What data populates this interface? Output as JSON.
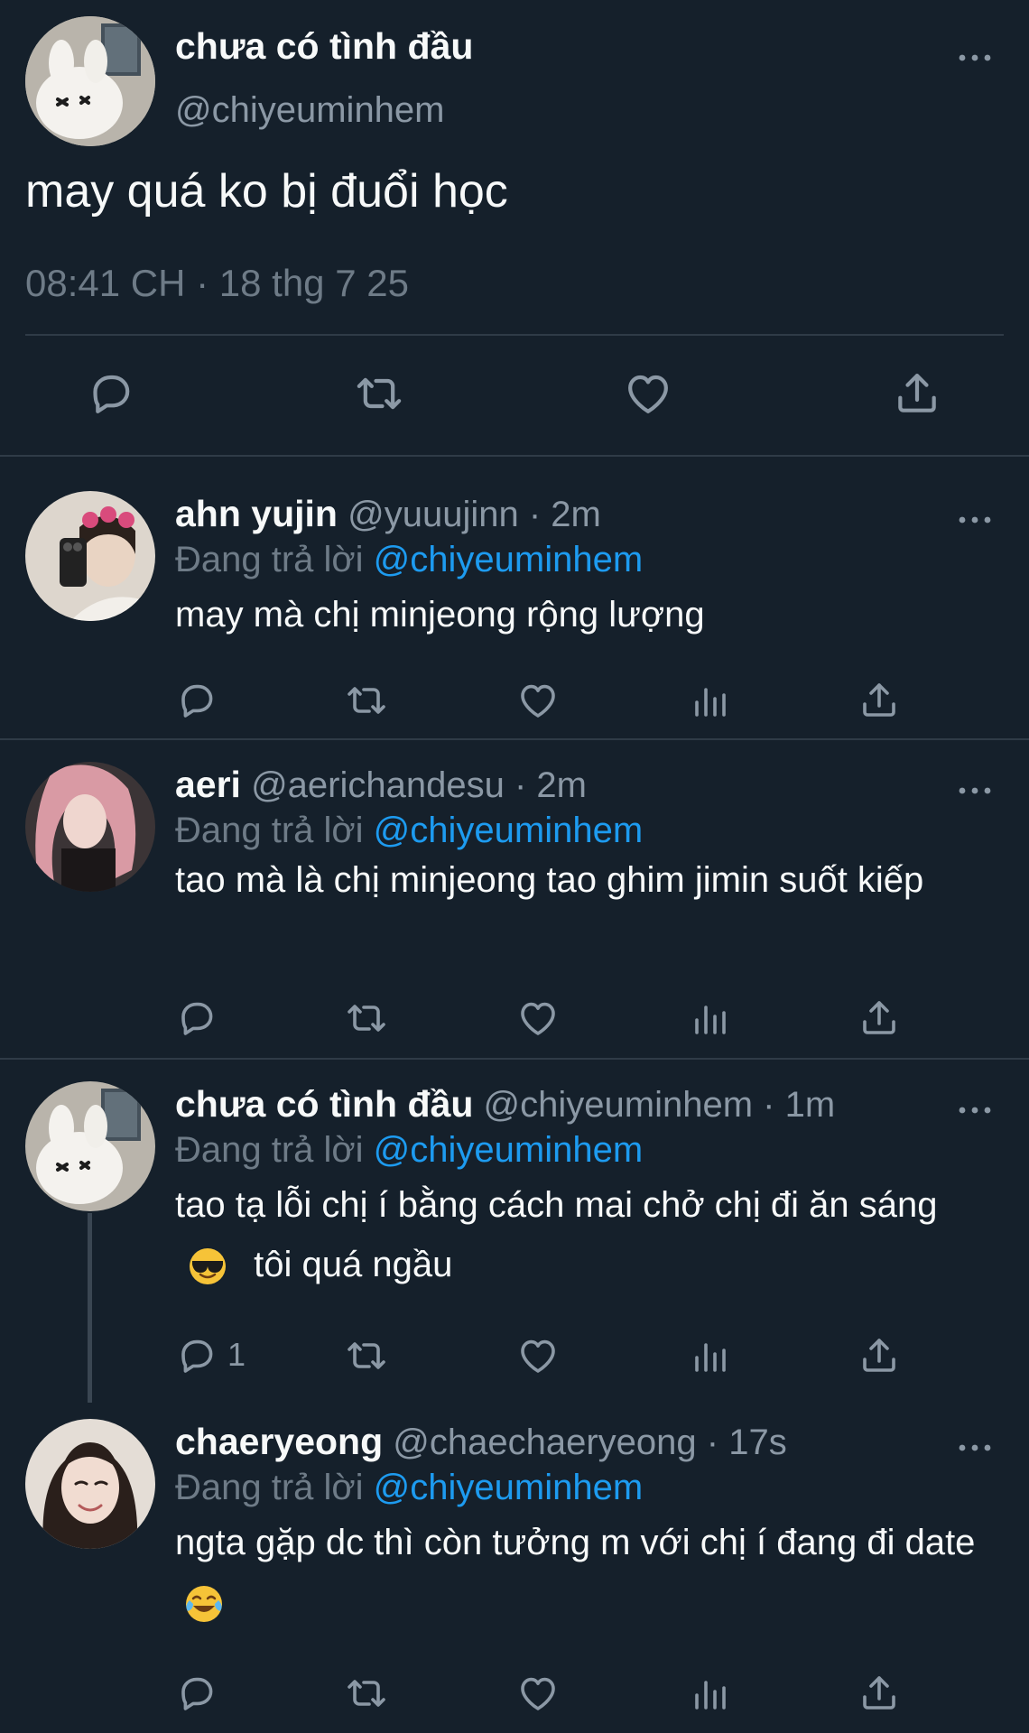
{
  "main_tweet": {
    "display_name": "chưa có tình đầu",
    "handle": "@chiyeuminhem",
    "text": "may quá ko bị đuổi học",
    "timestamp": "08:41 CH · 18 thg 7 25",
    "actions": [
      "reply-icon",
      "retweet-icon",
      "like-icon",
      "share-icon"
    ]
  },
  "replies": [
    {
      "display_name": "ahn yujin",
      "handle": "@yuuujinn",
      "time": "· 2m",
      "replying_prefix": "Đang trả lời",
      "replying_to": "@chiyeuminhem",
      "text": "may mà chị minjeong rộng lượng",
      "reply_count": ""
    },
    {
      "display_name": "aeri",
      "handle": "@aerichandesu",
      "time": "· 2m",
      "replying_prefix": "Đang trả lời",
      "replying_to": "@chiyeuminhem",
      "text": "tao mà là chị minjeong tao ghim jimin suốt kiếp",
      "reply_count": ""
    },
    {
      "display_name": "chưa có tình đầu",
      "handle": "@chiyeuminhem",
      "time": "· 1m",
      "replying_prefix": "Đang trả lời",
      "replying_to": "@chiyeuminhem",
      "text_before_emoji": "tao tạ lỗi chị í bằng cách mai chở chị đi ăn sáng",
      "emoji": "smiling-face-with-sunglasses-emoji",
      "text_after_emoji": "tôi quá ngầu",
      "reply_count": "1"
    },
    {
      "display_name": "chaeryeong",
      "handle": "@chaechaeryeong",
      "time": "· 17s",
      "replying_prefix": "Đang trả lời",
      "replying_to": "@chiyeuminhem",
      "text_before_emoji": "ngta gặp dc thì còn tưởng m với chị í đang đi date",
      "emoji": "face-with-tears-of-joy-emoji",
      "text_after_emoji": "",
      "reply_count": ""
    }
  ],
  "colors": {
    "background": "#15202b",
    "primary_text": "#f7f9f9",
    "secondary_text": "#8b98a5",
    "mention": "#1d9bf0",
    "divider": "#2f3b47"
  }
}
